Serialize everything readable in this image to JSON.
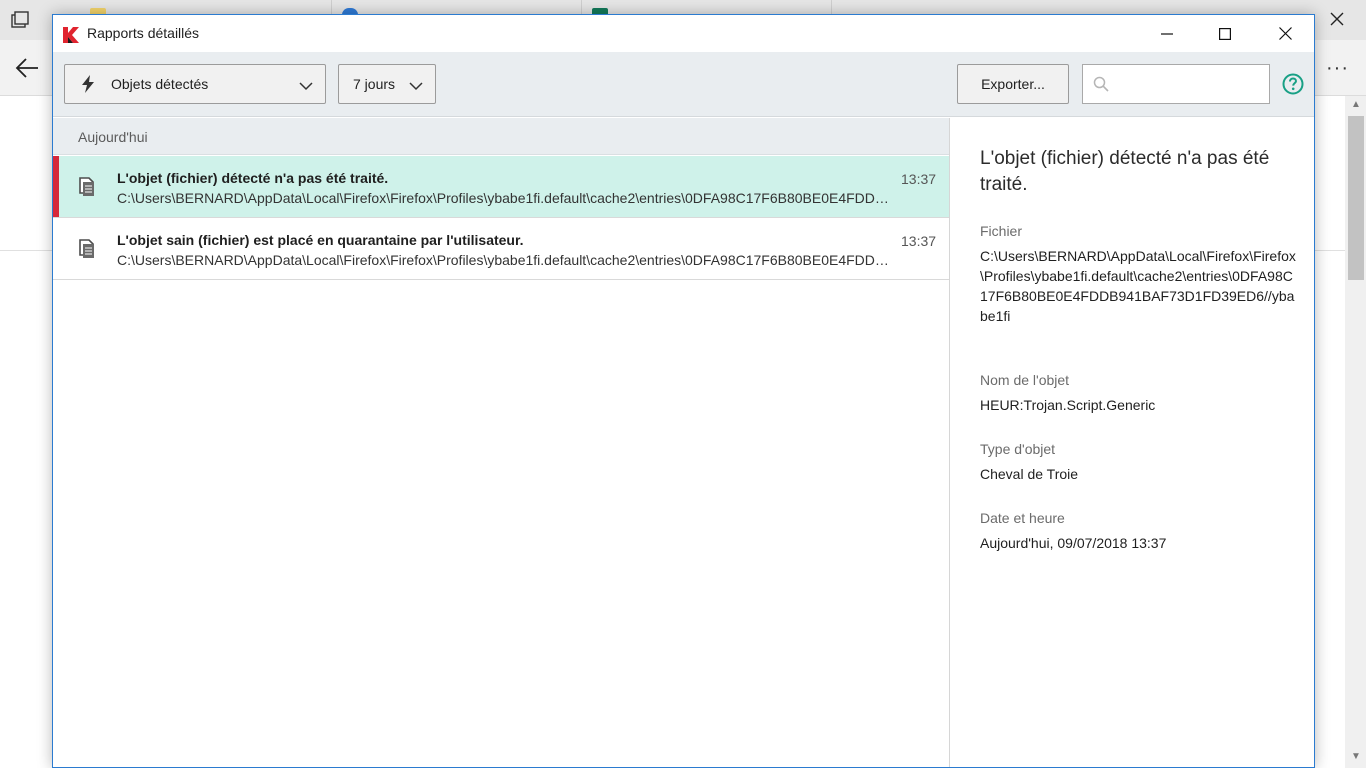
{
  "window": {
    "title": "Rapports détaillés"
  },
  "toolbar": {
    "filter_label": "Objets détectés",
    "period_label": "7 jours",
    "export_label": "Exporter...",
    "search_value": "",
    "search_placeholder": ""
  },
  "list": {
    "group_header": "Aujourd'hui",
    "items": [
      {
        "title": "L'objet (fichier) détecté n'a pas été traité.",
        "path": "C:\\Users\\BERNARD\\AppData\\Local\\Firefox\\Firefox\\Profiles\\ybabe1fi.default\\cache2\\entries\\0DFA98C17F6B80BE0E4FDDB941BAF73D1FD39ED6//ybabe1fi",
        "time": "13:37",
        "selected": true
      },
      {
        "title": "L'objet sain (fichier) est placé en quarantaine par l'utilisateur.",
        "path": "C:\\Users\\BERNARD\\AppData\\Local\\Firefox\\Firefox\\Profiles\\ybabe1fi.default\\cache2\\entries\\0DFA98C17F6B80BE0E4FDDB941BAF73D1FD39ED6//ybabe1fi",
        "time": "13:37",
        "selected": false
      }
    ]
  },
  "detail": {
    "title": "L'objet (fichier) détecté n'a pas été traité.",
    "file_label": "Fichier",
    "file_value": "C:\\Users\\BERNARD\\AppData\\Local\\Firefox\\Firefox\\Profiles\\ybabe1fi.default\\cache2\\entries\\0DFA98C17F6B80BE0E4FDDB941BAF73D1FD39ED6//ybabe1fi",
    "object_name_label": "Nom de l'objet",
    "object_name_value": "HEUR:Trojan.Script.Generic",
    "object_type_label": "Type d'objet",
    "object_type_value": "Cheval de Troie",
    "datetime_label": "Date et heure",
    "datetime_value": "Aujourd'hui, 09/07/2018 13:37"
  },
  "colors": {
    "accent_selection": "#cff2ea",
    "marker_red": "#d6283b",
    "help_green": "#18a085",
    "window_border": "#2b7bd0"
  },
  "icons": {
    "app": "kaspersky-logo",
    "filter": "lightning-icon",
    "search": "search-icon",
    "help": "help-icon",
    "row": "file-copy-icon"
  }
}
